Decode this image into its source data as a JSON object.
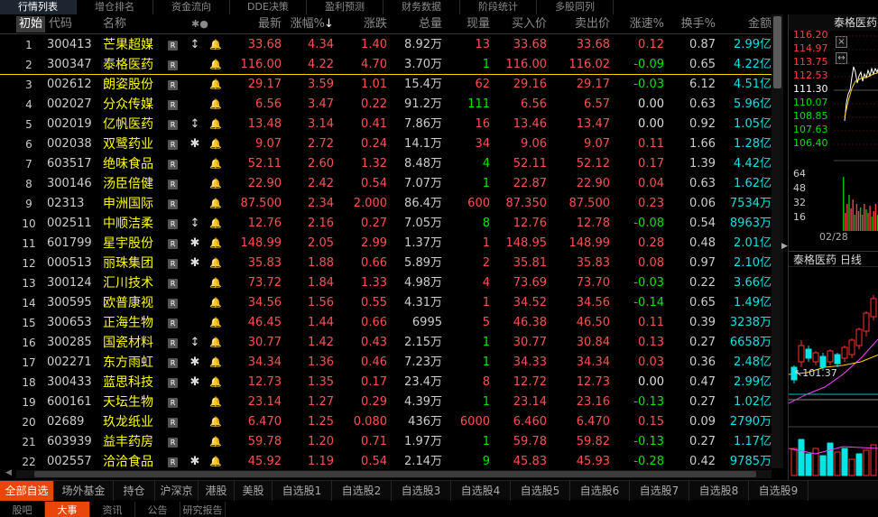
{
  "top_tabs": [
    "行情列表",
    "增仓排名",
    "资金流向",
    "DDE决策",
    "盈利预测",
    "财务数据",
    "阶段统计",
    "多股同列"
  ],
  "header": {
    "init_label": "初始",
    "code": "代码",
    "name": "名称",
    "flags": "✱●",
    "last": "最新",
    "pct": "涨幅%",
    "pct_sort": "↓",
    "chg": "涨跌",
    "vol": "总量",
    "cur": "现量",
    "buy": "买入价",
    "sell": "卖出价",
    "spd": "涨速%",
    "turn": "换手%",
    "amt": "金额"
  },
  "rows": [
    {
      "idx": "1",
      "code": "300413",
      "name": "芒果超媒",
      "flag": "↕",
      "last": "33.68",
      "pct": "4.34",
      "chg": "1.40",
      "vol": "8.92万",
      "cur": "13",
      "buy": "33.68",
      "sell": "33.68",
      "spd": "0.12",
      "turn": "0.87",
      "amt": "2.99亿",
      "cur_c": "red",
      "spd_c": "red"
    },
    {
      "idx": "2",
      "code": "300347",
      "name": "泰格医药",
      "flag": "",
      "last": "116.00",
      "pct": "4.22",
      "chg": "4.70",
      "vol": "3.70万",
      "cur": "1",
      "buy": "116.00",
      "sell": "116.02",
      "spd": "-0.09",
      "turn": "0.65",
      "amt": "4.22亿",
      "cur_c": "green",
      "spd_c": "green"
    },
    {
      "idx": "3",
      "code": "002612",
      "name": "朗姿股份",
      "flag": "",
      "last": "29.17",
      "pct": "3.59",
      "chg": "1.01",
      "vol": "15.4万",
      "cur": "62",
      "buy": "29.16",
      "sell": "29.17",
      "spd": "-0.03",
      "turn": "6.12",
      "amt": "4.51亿",
      "cur_c": "red",
      "spd_c": "green"
    },
    {
      "idx": "4",
      "code": "002027",
      "name": "分众传媒",
      "flag": "",
      "last": "6.56",
      "pct": "3.47",
      "chg": "0.22",
      "vol": "91.2万",
      "cur": "111",
      "buy": "6.56",
      "sell": "6.57",
      "spd": "0.00",
      "turn": "0.63",
      "amt": "5.96亿",
      "cur_c": "green",
      "spd_c": "white"
    },
    {
      "idx": "5",
      "code": "002019",
      "name": "亿帆医药",
      "flag": "↕",
      "last": "13.48",
      "pct": "3.14",
      "chg": "0.41",
      "vol": "7.86万",
      "cur": "16",
      "buy": "13.46",
      "sell": "13.47",
      "spd": "0.00",
      "turn": "0.92",
      "amt": "1.05亿",
      "cur_c": "red",
      "spd_c": "white"
    },
    {
      "idx": "6",
      "code": "002038",
      "name": "双鹭药业",
      "flag": "✱",
      "last": "9.07",
      "pct": "2.72",
      "chg": "0.24",
      "vol": "14.1万",
      "cur": "34",
      "buy": "9.06",
      "sell": "9.07",
      "spd": "0.11",
      "turn": "1.66",
      "amt": "1.28亿",
      "cur_c": "red",
      "spd_c": "red"
    },
    {
      "idx": "7",
      "code": "603517",
      "name": "绝味食品",
      "flag": "",
      "last": "52.11",
      "pct": "2.60",
      "chg": "1.32",
      "vol": "8.48万",
      "cur": "4",
      "buy": "52.11",
      "sell": "52.12",
      "spd": "0.17",
      "turn": "1.39",
      "amt": "4.42亿",
      "cur_c": "green",
      "spd_c": "red"
    },
    {
      "idx": "8",
      "code": "300146",
      "name": "汤臣倍健",
      "flag": "",
      "last": "22.90",
      "pct": "2.42",
      "chg": "0.54",
      "vol": "7.07万",
      "cur": "1",
      "buy": "22.87",
      "sell": "22.90",
      "spd": "0.04",
      "turn": "0.63",
      "amt": "1.62亿",
      "cur_c": "green",
      "spd_c": "red"
    },
    {
      "idx": "9",
      "code": "02313",
      "name": "申洲国际",
      "flag": "",
      "last": "87.500",
      "pct": "2.34",
      "chg": "2.000",
      "vol": "86.4万",
      "cur": "600",
      "buy": "87.350",
      "sell": "87.500",
      "spd": "0.23",
      "turn": "0.06",
      "amt": "7534万",
      "cur_c": "red",
      "spd_c": "red"
    },
    {
      "idx": "10",
      "code": "002511",
      "name": "中顺洁柔",
      "flag": "↕",
      "last": "12.76",
      "pct": "2.16",
      "chg": "0.27",
      "vol": "7.05万",
      "cur": "8",
      "buy": "12.76",
      "sell": "12.78",
      "spd": "-0.08",
      "turn": "0.54",
      "amt": "8963万",
      "cur_c": "green",
      "spd_c": "green"
    },
    {
      "idx": "11",
      "code": "601799",
      "name": "星宇股份",
      "flag": "✱",
      "last": "148.99",
      "pct": "2.05",
      "chg": "2.99",
      "vol": "1.37万",
      "cur": "1",
      "buy": "148.95",
      "sell": "148.99",
      "spd": "0.28",
      "turn": "0.48",
      "amt": "2.01亿",
      "cur_c": "red",
      "spd_c": "red"
    },
    {
      "idx": "12",
      "code": "000513",
      "name": "丽珠集团",
      "flag": "✱",
      "last": "35.83",
      "pct": "1.88",
      "chg": "0.66",
      "vol": "5.89万",
      "cur": "2",
      "buy": "35.81",
      "sell": "35.83",
      "spd": "0.08",
      "turn": "0.97",
      "amt": "2.10亿",
      "cur_c": "red",
      "spd_c": "red"
    },
    {
      "idx": "13",
      "code": "300124",
      "name": "汇川技术",
      "flag": "",
      "last": "73.72",
      "pct": "1.84",
      "chg": "1.33",
      "vol": "4.98万",
      "cur": "4",
      "buy": "73.69",
      "sell": "73.70",
      "spd": "-0.03",
      "turn": "0.22",
      "amt": "3.66亿",
      "cur_c": "red",
      "spd_c": "green"
    },
    {
      "idx": "14",
      "code": "300595",
      "name": "欧普康视",
      "flag": "",
      "last": "34.56",
      "pct": "1.56",
      "chg": "0.55",
      "vol": "4.31万",
      "cur": "1",
      "buy": "34.52",
      "sell": "34.56",
      "spd": "-0.14",
      "turn": "0.65",
      "amt": "1.49亿",
      "cur_c": "red",
      "spd_c": "green"
    },
    {
      "idx": "15",
      "code": "300653",
      "name": "正海生物",
      "flag": "",
      "last": "46.45",
      "pct": "1.44",
      "chg": "0.66",
      "vol": "6995",
      "cur": "5",
      "buy": "46.38",
      "sell": "46.50",
      "spd": "0.11",
      "turn": "0.39",
      "amt": "3238万",
      "cur_c": "red",
      "spd_c": "red"
    },
    {
      "idx": "16",
      "code": "300285",
      "name": "国瓷材料",
      "flag": "↕",
      "last": "30.77",
      "pct": "1.42",
      "chg": "0.43",
      "vol": "2.15万",
      "cur": "1",
      "buy": "30.77",
      "sell": "30.84",
      "spd": "0.13",
      "turn": "0.27",
      "amt": "6658万",
      "cur_c": "green",
      "spd_c": "red"
    },
    {
      "idx": "17",
      "code": "002271",
      "name": "东方雨虹",
      "flag": "✱",
      "last": "34.34",
      "pct": "1.36",
      "chg": "0.46",
      "vol": "7.23万",
      "cur": "1",
      "buy": "34.33",
      "sell": "34.34",
      "spd": "0.03",
      "turn": "0.36",
      "amt": "2.48亿",
      "cur_c": "green",
      "spd_c": "red"
    },
    {
      "idx": "18",
      "code": "300433",
      "name": "蓝思科技",
      "flag": "✱",
      "last": "12.73",
      "pct": "1.35",
      "chg": "0.17",
      "vol": "23.4万",
      "cur": "8",
      "buy": "12.72",
      "sell": "12.73",
      "spd": "0.00",
      "turn": "0.47",
      "amt": "2.99亿",
      "cur_c": "red",
      "spd_c": "white"
    },
    {
      "idx": "19",
      "code": "600161",
      "name": "天坛生物",
      "flag": "",
      "last": "23.14",
      "pct": "1.27",
      "chg": "0.29",
      "vol": "4.39万",
      "cur": "1",
      "buy": "23.14",
      "sell": "23.16",
      "spd": "-0.13",
      "turn": "0.27",
      "amt": "1.02亿",
      "cur_c": "green",
      "spd_c": "green"
    },
    {
      "idx": "20",
      "code": "02689",
      "name": "玖龙纸业",
      "flag": "",
      "last": "6.470",
      "pct": "1.25",
      "chg": "0.080",
      "vol": "436万",
      "cur": "6000",
      "buy": "6.460",
      "sell": "6.470",
      "spd": "0.15",
      "turn": "0.09",
      "amt": "2790万",
      "cur_c": "red",
      "spd_c": "red"
    },
    {
      "idx": "21",
      "code": "603939",
      "name": "益丰药房",
      "flag": "",
      "last": "59.78",
      "pct": "1.20",
      "chg": "0.71",
      "vol": "1.97万",
      "cur": "1",
      "buy": "59.78",
      "sell": "59.82",
      "spd": "-0.13",
      "turn": "0.27",
      "amt": "1.17亿",
      "cur_c": "green",
      "spd_c": "green"
    },
    {
      "idx": "22",
      "code": "002557",
      "name": "洽洽食品",
      "flag": "✱",
      "last": "45.92",
      "pct": "1.19",
      "chg": "0.54",
      "vol": "2.14万",
      "cur": "9",
      "buy": "45.83",
      "sell": "45.93",
      "spd": "-0.28",
      "turn": "0.42",
      "amt": "9785万",
      "cur_c": "green",
      "spd_c": "green"
    }
  ],
  "bottom_tabs": [
    "全部自选",
    "场外基金",
    "持仓",
    "沪深京",
    "港股",
    "美股",
    "自选股1",
    "自选股2",
    "自选股3",
    "自选股4",
    "自选股5",
    "自选股6",
    "自选股7",
    "自选股8",
    "自选股9"
  ],
  "bottom_tabs2": [
    "股吧",
    "大事",
    "资讯",
    "公告",
    "研究报告"
  ],
  "right_panel": {
    "title": "泰格医药",
    "price_scale": [
      "116.20",
      "114.97",
      "113.75",
      "112.53",
      "111.30",
      "110.07",
      "108.85",
      "107.63",
      "106.40"
    ],
    "scale_colors": [
      "#ff4040",
      "#ff4040",
      "#ff4040",
      "#ff4040",
      "#ffffff",
      "#00e000",
      "#00e000",
      "#00e000",
      "#00e000"
    ],
    "vol_scale": [
      "64",
      "48",
      "32",
      "16"
    ],
    "date": "02/28",
    "daily_title": "泰格医药 日线",
    "low_label": "101.37",
    "close_icon": "×",
    "resize_icon": "↔"
  }
}
